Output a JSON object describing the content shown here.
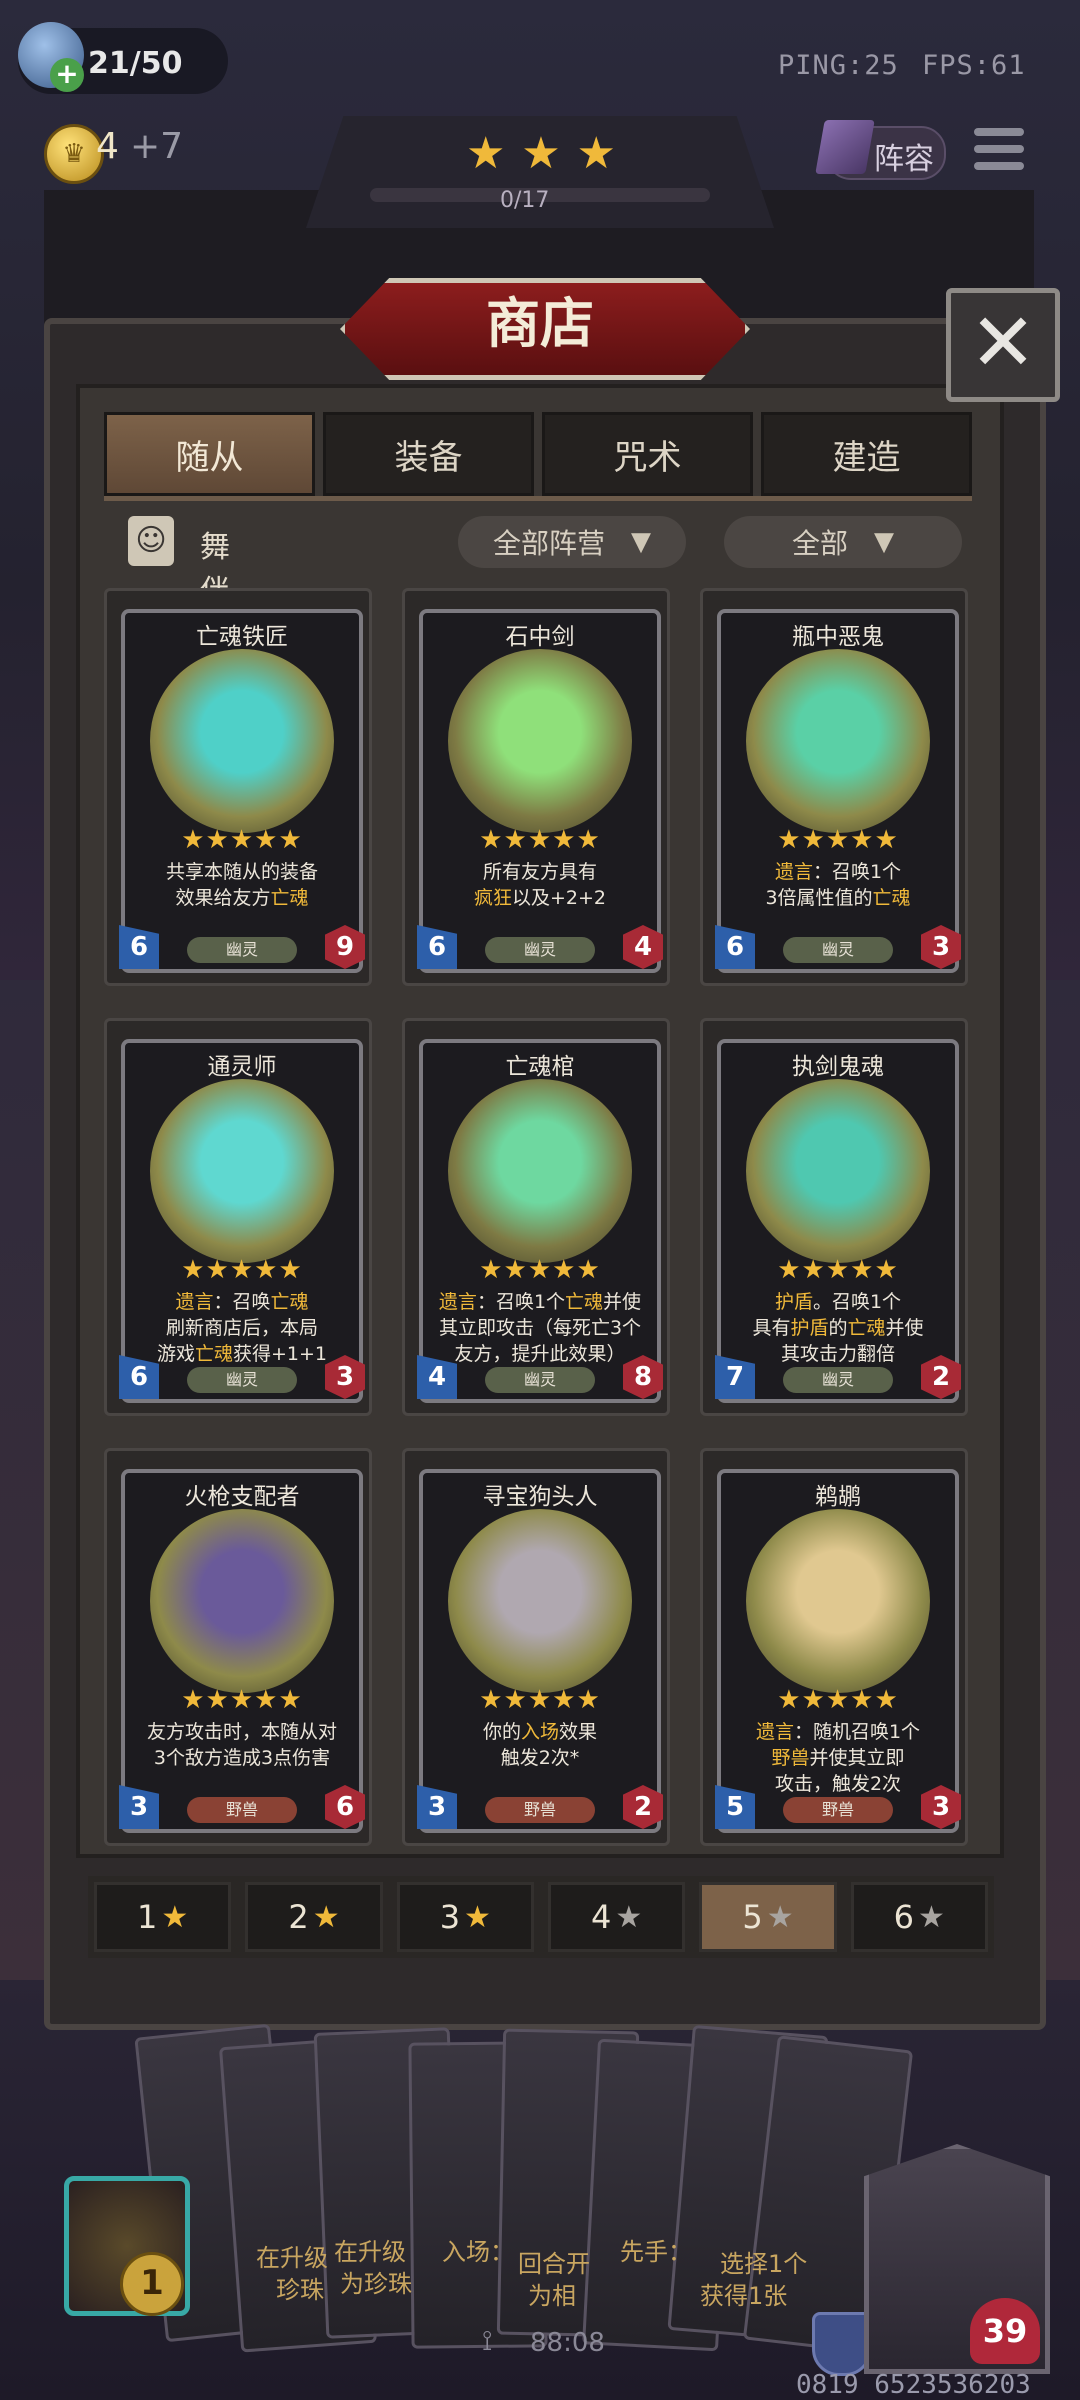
{
  "hud": {
    "player_count": "21/50",
    "gold": "4",
    "gold_income": "+7",
    "ping": "PING:25",
    "fps": "FPS:61",
    "lineup_label": "阵容",
    "stars_progress": "0/17"
  },
  "shop": {
    "title": "商店",
    "close_glyph": "✕",
    "tabs": [
      "随从",
      "装备",
      "咒术",
      "建造"
    ],
    "active_tab": 0,
    "filter_tag": "舞伴",
    "filter_faction": "全部阵营",
    "filter_all": "全部",
    "cards": [
      {
        "name": "亡魂铁匠",
        "stars": 5,
        "desc": [
          "共享本随从的装备",
          "效果给友方<hl>亡魂</hl>"
        ],
        "type": "幽灵",
        "atk": "6",
        "hp": "9",
        "art": "#4fd0c8",
        "artbg": "#8e8a4a"
      },
      {
        "name": "石中剑",
        "stars": 5,
        "desc": [
          "所有友方具有",
          "<hl>疯狂</hl>以及+2+2"
        ],
        "type": "幽灵",
        "atk": "6",
        "hp": "4",
        "art": "#8fe07a",
        "artbg": "#7e7a44"
      },
      {
        "name": "瓶中恶鬼",
        "stars": 5,
        "desc": [
          "<hl>遗言</hl>：召唤1个",
          "3倍属性值的<hl>亡魂</hl>"
        ],
        "type": "幽灵",
        "atk": "6",
        "hp": "3",
        "art": "#5ad0a6",
        "artbg": "#8e8a4a"
      },
      {
        "name": "通灵师",
        "stars": 5,
        "desc": [
          "<hl>遗言</hl>：召唤<hl>亡魂</hl>",
          "刷新商店后，本局",
          "游戏<hl>亡魂</hl>获得+1+1"
        ],
        "type": "幽灵",
        "atk": "6",
        "hp": "3",
        "art": "#5fd8d0",
        "artbg": "#8e8a4a"
      },
      {
        "name": "亡魂棺",
        "stars": 5,
        "desc": [
          "<hl>遗言</hl>：召唤1个<hl>亡魂</hl>并使",
          "其立即攻击（每死亡3个",
          "友方，提升此效果）"
        ],
        "type": "幽灵",
        "atk": "4",
        "hp": "8",
        "art": "#6ed8a0",
        "artbg": "#7e7a44"
      },
      {
        "name": "执剑鬼魂",
        "stars": 5,
        "desc": [
          "<hl>护盾</hl>。召唤1个",
          "具有<hl>护盾</hl>的<hl>亡魂</hl>并使",
          "其攻击力翻倍"
        ],
        "type": "幽灵",
        "atk": "7",
        "hp": "2",
        "art": "#4fc8b0",
        "artbg": "#8e8a4a"
      },
      {
        "name": "火枪支配者",
        "stars": 5,
        "desc": [
          "友方攻击时，本随从对",
          "3个敌方造成3点伤害"
        ],
        "type": "野兽",
        "atk": "3",
        "hp": "6",
        "art": "#6a5a9a",
        "artbg": "#8e8a4a"
      },
      {
        "name": "寻宝狗头人",
        "stars": 5,
        "desc": [
          "你的<hl>入场</hl>效果",
          "触发2次*"
        ],
        "type": "野兽",
        "atk": "3",
        "hp": "2",
        "art": "#b0a8b0",
        "artbg": "#8e8a4a"
      },
      {
        "name": "鹈鹕",
        "stars": 5,
        "desc": [
          "<hl>遗言</hl>：随机召唤1个",
          "<hl>野兽</hl>并使其立即",
          "攻击，触发2次"
        ],
        "type": "野兽",
        "atk": "5",
        "hp": "3",
        "art": "#e0c890",
        "artbg": "#8e8a4a"
      }
    ],
    "star_filters": [
      "1",
      "2",
      "3",
      "4",
      "5",
      "6"
    ],
    "star_filter_active": 4
  },
  "bottom": {
    "hand_texts": [
      "在升级",
      "珍珠",
      "在升级",
      "为珍珠",
      "入场：",
      "回合开",
      "为相",
      "先手：",
      "选择1个",
      "获得1张"
    ],
    "hero_level": "1",
    "timer": "88:08",
    "hero_hp": "39",
    "id_watermark": "0819 6523536203"
  },
  "colors": {
    "accent_gold": "#f0b93a",
    "tab_active": "#7d6249",
    "atk_blue": "#2d5faa",
    "hp_red": "#a82a36"
  }
}
